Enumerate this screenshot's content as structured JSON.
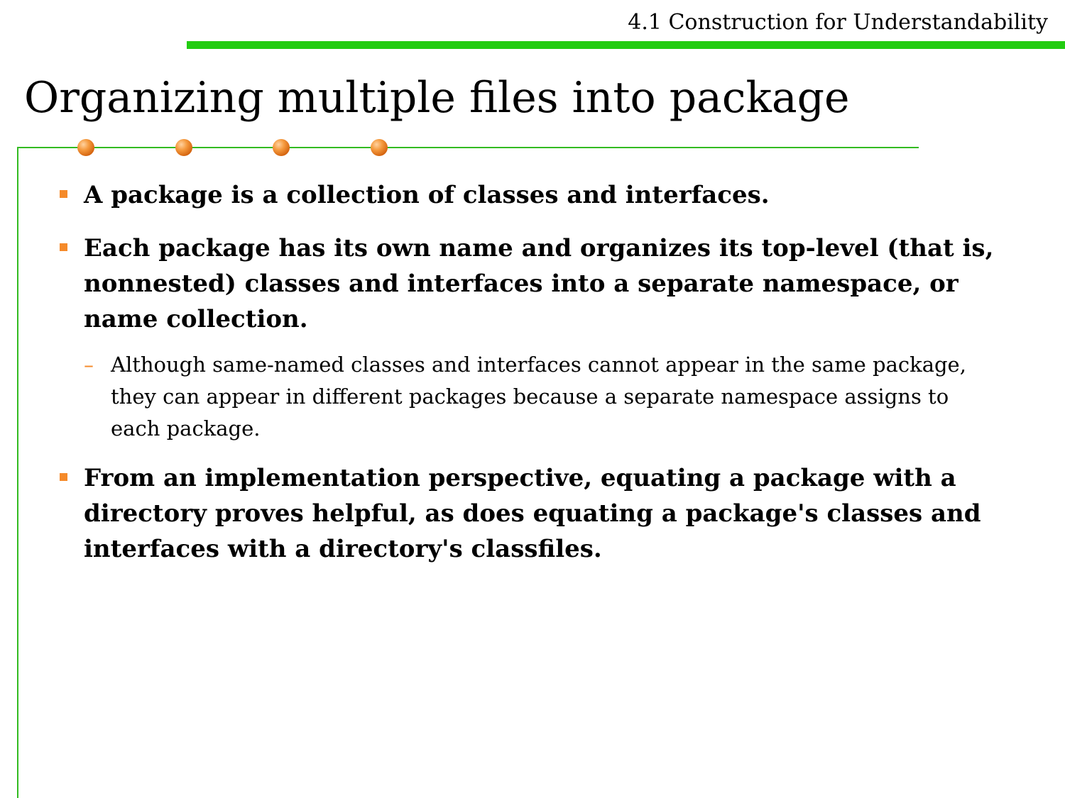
{
  "header": {
    "section_label": "4.1 Construction for Understandability"
  },
  "title": "Organizing multiple files into package",
  "colors": {
    "top_bar": "#22cc11",
    "frame_line": "#33bb22",
    "bullet_marker": "#f58a2a",
    "dot": "#e0701a"
  },
  "bullets": [
    {
      "text": "A package is a collection of classes and interfaces."
    },
    {
      "text": "Each package has its own name and organizes its top-level (that is, nonnested) classes and interfaces into a separate namespace, or name collection."
    },
    {
      "text": "From an implementation perspective, equating a package with a directory proves helpful, as does equating a package's classes and interfaces with a directory's classfiles."
    }
  ],
  "sub_bullets": [
    {
      "marker": "–",
      "text": "Although same-named classes and interfaces cannot appear in the same package, they can appear in different packages because a separate namespace assigns to each package."
    }
  ]
}
